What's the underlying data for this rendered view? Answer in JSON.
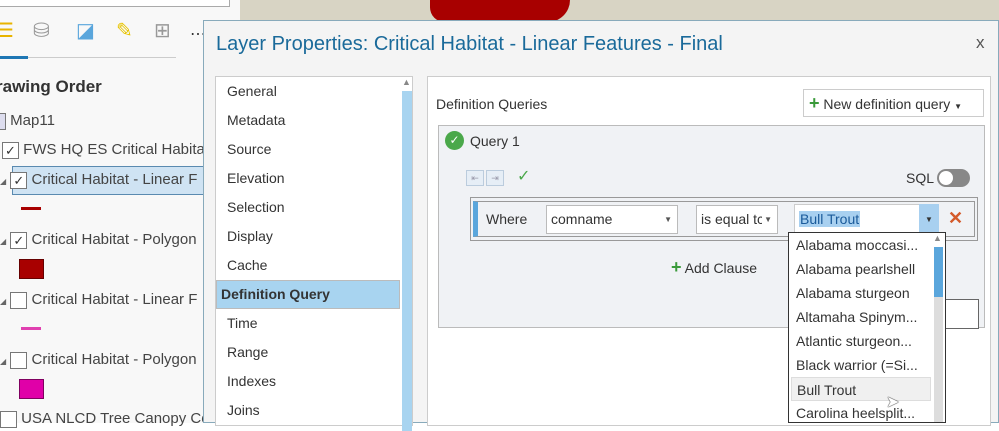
{
  "contents_pane": {
    "section_title": "rawing Order",
    "toolbar_icons": [
      "list-by-drawing-order-icon",
      "list-by-source-icon",
      "list-by-selection-icon",
      "list-by-editing-icon",
      "list-by-snapping-icon"
    ],
    "layers": [
      {
        "label": "Map11",
        "checked": null
      },
      {
        "label": "FWS HQ ES Critical Habitat",
        "checked": true
      },
      {
        "label": "Critical Habitat - Linear F",
        "checked": true,
        "selected": true,
        "symbol_color": "#a80000"
      },
      {
        "label": "Critical Habitat - Polygon",
        "checked": true,
        "symbol_color": "#a80000"
      },
      {
        "label": "Critical Habitat - Linear F",
        "checked": false,
        "symbol_color": "#e040b0"
      },
      {
        "label": "Critical Habitat - Polygon",
        "checked": false,
        "symbol_color": "#e000a8"
      },
      {
        "label": "USA NLCD Tree Canopy Co",
        "checked": false
      }
    ]
  },
  "dialog": {
    "title": "Layer Properties: Critical Habitat - Linear Features - Final",
    "close": "x",
    "nav": [
      "General",
      "Metadata",
      "Source",
      "Elevation",
      "Selection",
      "Display",
      "Cache",
      "Definition Query",
      "Time",
      "Range",
      "Indexes",
      "Joins"
    ],
    "nav_selected": "Definition Query",
    "section_label": "Definition Queries",
    "new_query_button": "New definition query",
    "query": {
      "name": "Query 1",
      "sql_label": "SQL",
      "sql_on": false,
      "where_label": "Where",
      "field": "comname",
      "operator": "is equal tc",
      "value": "Bull Trout",
      "add_clause": "Add Clause"
    },
    "dropdown_options": [
      "Alabama moccasi...",
      "Alabama pearlshell",
      "Alabama sturgeon",
      "Altamaha Spinym...",
      "Atlantic sturgeon...",
      "Black warrior (=Si...",
      "Bull Trout",
      "Carolina heelsplit..."
    ],
    "dropdown_hovered": "Bull Trout"
  },
  "colors": {
    "accent": "#1a6a9a",
    "selection": "#a8d4f0",
    "ok": "#4aa84a",
    "delete": "#d45a2a"
  }
}
